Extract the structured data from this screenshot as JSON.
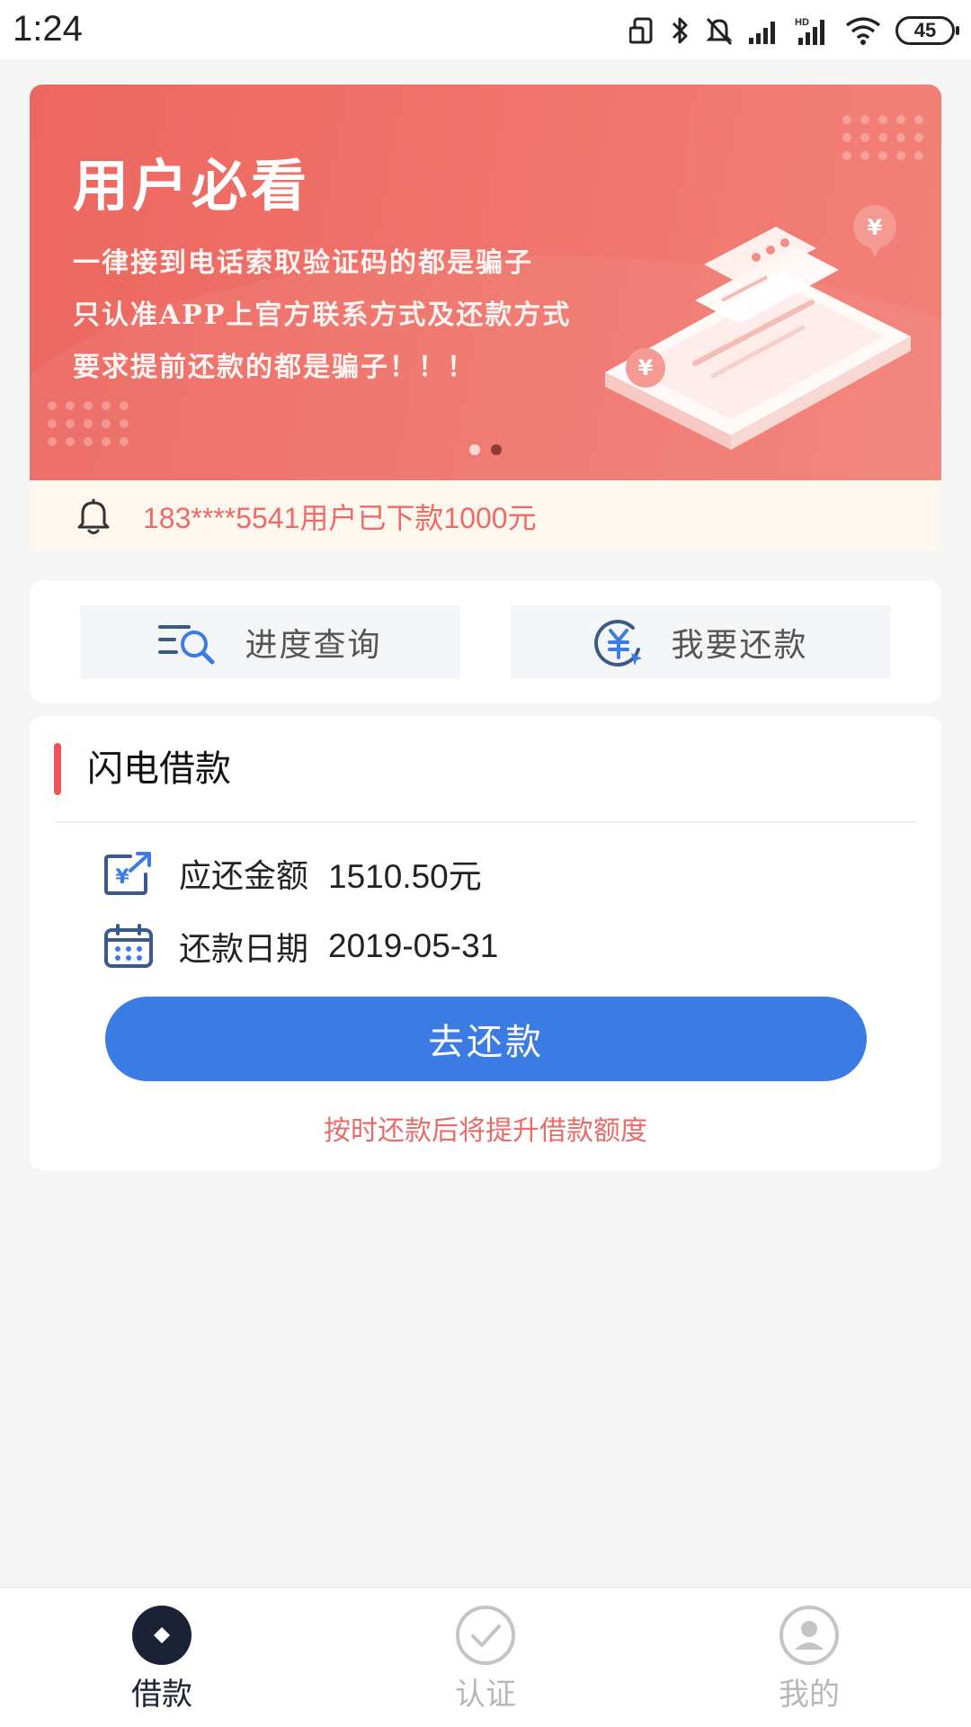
{
  "status_bar": {
    "time": "1:24",
    "battery": "45",
    "icons": [
      "screen-rotate-icon",
      "bluetooth-icon",
      "bell-muted-icon",
      "cell-signal-icon",
      "hd-signal-icon",
      "wifi-icon",
      "battery-icon"
    ]
  },
  "banner": {
    "title": "用户必看",
    "lines": [
      "一律接到电话索取验证码的都是骗子",
      "只认准APP上官方联系方式及还款方式",
      "要求提前还款的都是骗子！！！"
    ],
    "currency_symbol": "¥",
    "page_count": 2,
    "active_page": 2
  },
  "notice": {
    "text": "183****5541用户已下款1000元",
    "icon": "bell-icon"
  },
  "quick_actions": [
    {
      "label": "进度查询",
      "icon": "progress-search-icon"
    },
    {
      "label": "我要还款",
      "icon": "repay-yuan-icon"
    }
  ],
  "loan": {
    "title": "闪电借款",
    "amount_label": "应还金额",
    "amount_value": "1510.50元",
    "date_label": "还款日期",
    "date_value": "2019-05-31",
    "button_label": "去还款",
    "hint": "按时还款后将提升借款额度",
    "colors": {
      "accent": "#e9555a",
      "button": "#3b7be4",
      "hint": "#ea6a6a"
    }
  },
  "bottom_nav": {
    "items": [
      {
        "label": "借款",
        "icon": "loan-diamond-icon",
        "active": true
      },
      {
        "label": "认证",
        "icon": "check-circle-icon",
        "active": false
      },
      {
        "label": "我的",
        "icon": "user-profile-icon",
        "active": false
      }
    ]
  }
}
